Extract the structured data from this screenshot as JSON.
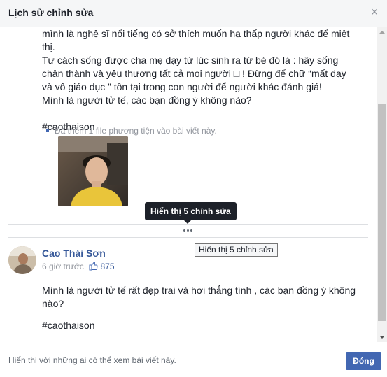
{
  "dialog": {
    "title": "Lịch sử chỉnh sửa",
    "close_symbol": "×"
  },
  "previous_edit": {
    "lines": [
      "mình là nghệ sĩ nổi tiếng có sở thích muốn hạ thấp người khác để miệt thị.",
      "Tư cách sống được cha mẹ dạy từ lúc sinh ra từ bé đó là : hãy sống chân thành và yêu thương tất cả mọi người □ ! Đừng để chữ “mất dạy và vô giáo dục ” tồn tại trong con người để người khác đánh giá!",
      "Mình là người tử tế, các bạn đồng ý không nào?"
    ],
    "hashtag": "#caothaison",
    "media_note": "Đã thêm 1 file phương tiện vào bài viết này."
  },
  "tooltips": {
    "dark": "Hiển thị 5 chỉnh sửa",
    "light": "Hiển thị 5 chỉnh sửa"
  },
  "current_post": {
    "author": "Cao Thái Sơn",
    "time": "6 giờ trước",
    "likes": "875",
    "text": "Mình là người tử tế rất đẹp trai và hơi thẳng tính , các bạn đồng ý không nào?",
    "hashtag": "#caothaison"
  },
  "footer": {
    "visibility_note": "Hiển thị với những ai có thể xem bài viết này.",
    "close_button": "Đóng"
  },
  "colors": {
    "link": "#365899",
    "button": "#4267b2"
  }
}
